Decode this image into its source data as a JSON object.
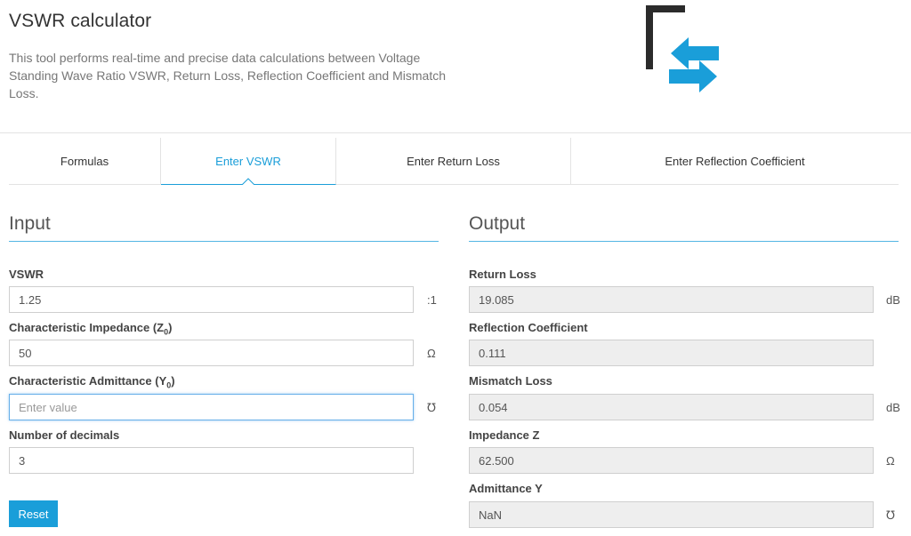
{
  "header": {
    "title": "VSWR calculator",
    "description": "This tool performs real-time and precise data calculations between Voltage Standing Wave Ratio VSWR, Return Loss, Reflection Coefficient and Mismatch Loss."
  },
  "tabs": [
    {
      "label": "Formulas",
      "active": false
    },
    {
      "label": "Enter VSWR",
      "active": true
    },
    {
      "label": "Enter Return Loss",
      "active": false
    },
    {
      "label": "Enter Reflection Coefficient",
      "active": false
    }
  ],
  "input": {
    "title": "Input",
    "vswr": {
      "label": "VSWR",
      "value": "1.25",
      "unit": ":1"
    },
    "impedance": {
      "label": "Characteristic Impedance (Z",
      "sub": "0",
      "label_end": ")",
      "value": "50",
      "unit": "Ω"
    },
    "admittance": {
      "label": "Characteristic Admittance (Y",
      "sub": "0",
      "label_end": ")",
      "value": "",
      "placeholder": "Enter value",
      "unit": "℧"
    },
    "decimals": {
      "label": "Number of decimals",
      "value": "3"
    },
    "reset_label": "Reset"
  },
  "output": {
    "title": "Output",
    "return_loss": {
      "label": "Return Loss",
      "value": "19.085",
      "unit": "dB"
    },
    "reflection": {
      "label": "Reflection Coefficient",
      "value": "0.111",
      "unit": ""
    },
    "mismatch": {
      "label": "Mismatch Loss",
      "value": "0.054",
      "unit": "dB"
    },
    "impedance_z": {
      "label": "Impedance Z",
      "value": "62.500",
      "unit": "Ω"
    },
    "admittance_y": {
      "label": "Admittance Y",
      "value": "NaN",
      "unit": "℧"
    }
  },
  "colors": {
    "accent": "#1a9ed9",
    "logo_dark": "#2b2b2b"
  },
  "icons": {
    "logo": "vswr-arrows-logo-icon"
  }
}
